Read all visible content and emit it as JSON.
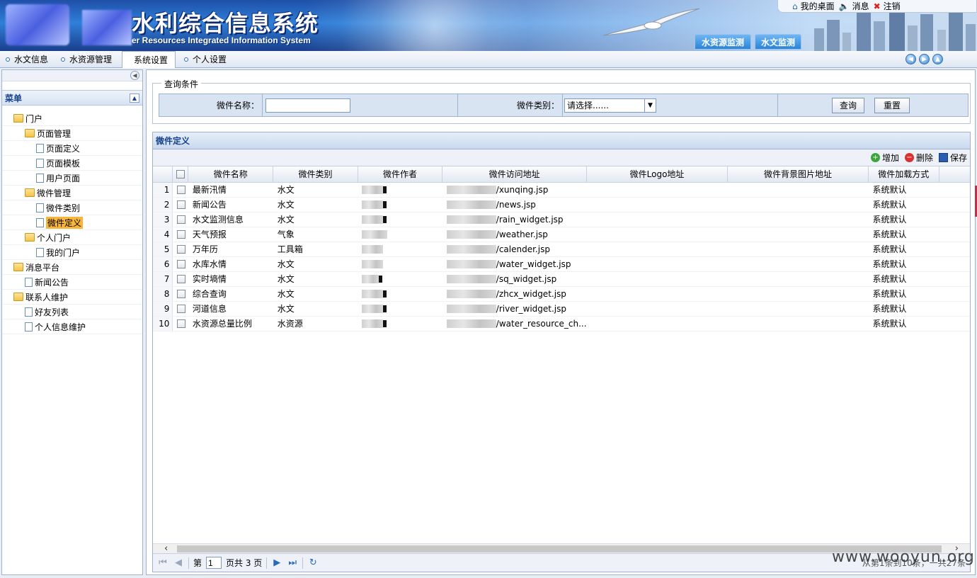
{
  "header": {
    "title_cn": "水利综合信息系统",
    "title_en": "er Resources Integrated Information System",
    "top_links": [
      {
        "label": "我的桌面",
        "icon": "home-icon"
      },
      {
        "label": "消息",
        "icon": "speaker-icon"
      },
      {
        "label": "注销",
        "icon": "close-icon"
      }
    ],
    "tabs": [
      "水资源监测",
      "水文监测"
    ]
  },
  "menu": {
    "items": [
      "水文信息",
      "水资源管理",
      "系统设置",
      "个人设置"
    ],
    "active": "系统设置"
  },
  "sidebar": {
    "title": "菜单",
    "tree": [
      {
        "label": "门户",
        "type": "folder",
        "level": 0
      },
      {
        "label": "页面管理",
        "type": "folder",
        "level": 1
      },
      {
        "label": "页面定义",
        "type": "file",
        "level": 2
      },
      {
        "label": "页面模板",
        "type": "file",
        "level": 2
      },
      {
        "label": "用户页面",
        "type": "file",
        "level": 2
      },
      {
        "label": "微件管理",
        "type": "folder",
        "level": 1
      },
      {
        "label": "微件类别",
        "type": "file",
        "level": 2
      },
      {
        "label": "微件定义",
        "type": "file",
        "level": 2,
        "selected": true
      },
      {
        "label": "个人门户",
        "type": "folder",
        "level": 1
      },
      {
        "label": "我的门户",
        "type": "file",
        "level": 2
      },
      {
        "label": "消息平台",
        "type": "folder",
        "level": 0
      },
      {
        "label": "新闻公告",
        "type": "file",
        "level": 1
      },
      {
        "label": "联系人维护",
        "type": "folder",
        "level": 0
      },
      {
        "label": "好友列表",
        "type": "file",
        "level": 1
      },
      {
        "label": "个人信息维护",
        "type": "file",
        "level": 1
      }
    ]
  },
  "query": {
    "legend": "查询条件",
    "name_label": "微件名称：",
    "name_value": "",
    "category_label": "微件类别：",
    "category_selected": "请选择......",
    "search_button": "查询",
    "reset_button": "重置"
  },
  "grid": {
    "title": "微件定义",
    "toolbar": {
      "add": "增加",
      "delete": "删除",
      "save": "保存"
    },
    "columns": [
      "微件名称",
      "微件类别",
      "微件作者",
      "微件访问地址",
      "微件Logo地址",
      "微件背景图片地址",
      "微件加载方式"
    ],
    "rows": [
      {
        "n": "1",
        "name": "最新汛情",
        "cat": "水文",
        "url": "/xunqing.jsp",
        "load": "系统默认"
      },
      {
        "n": "2",
        "name": "新闻公告",
        "cat": "水文",
        "url": "/news.jsp",
        "load": "系统默认"
      },
      {
        "n": "3",
        "name": "水文监测信息",
        "cat": "水文",
        "url": "/rain_widget.jsp",
        "load": "系统默认"
      },
      {
        "n": "4",
        "name": "天气预报",
        "cat": "气象",
        "url": "/weather.jsp",
        "load": "系统默认"
      },
      {
        "n": "5",
        "name": "万年历",
        "cat": "工具箱",
        "url": "/calender.jsp",
        "load": "系统默认"
      },
      {
        "n": "6",
        "name": "水库水情",
        "cat": "水文",
        "url": "/water_widget.jsp",
        "load": "系统默认"
      },
      {
        "n": "7",
        "name": "实时墒情",
        "cat": "水文",
        "url": "/sq_widget.jsp",
        "load": "系统默认"
      },
      {
        "n": "8",
        "name": "综合查询",
        "cat": "水文",
        "url": "/zhcx_widget.jsp",
        "load": "系统默认"
      },
      {
        "n": "9",
        "name": "河道信息",
        "cat": "水文",
        "url": "/river_widget.jsp",
        "load": "系统默认"
      },
      {
        "n": "10",
        "name": "水资源总量比例",
        "cat": "水资源",
        "url": "/water_resource_ch...",
        "load": "系统默认"
      }
    ]
  },
  "pager": {
    "prefix": "第",
    "page": "1",
    "suffix": "页共 3 页",
    "info": "从第1条到10条，一共27条"
  },
  "watermark": "www.wooyun.org"
}
